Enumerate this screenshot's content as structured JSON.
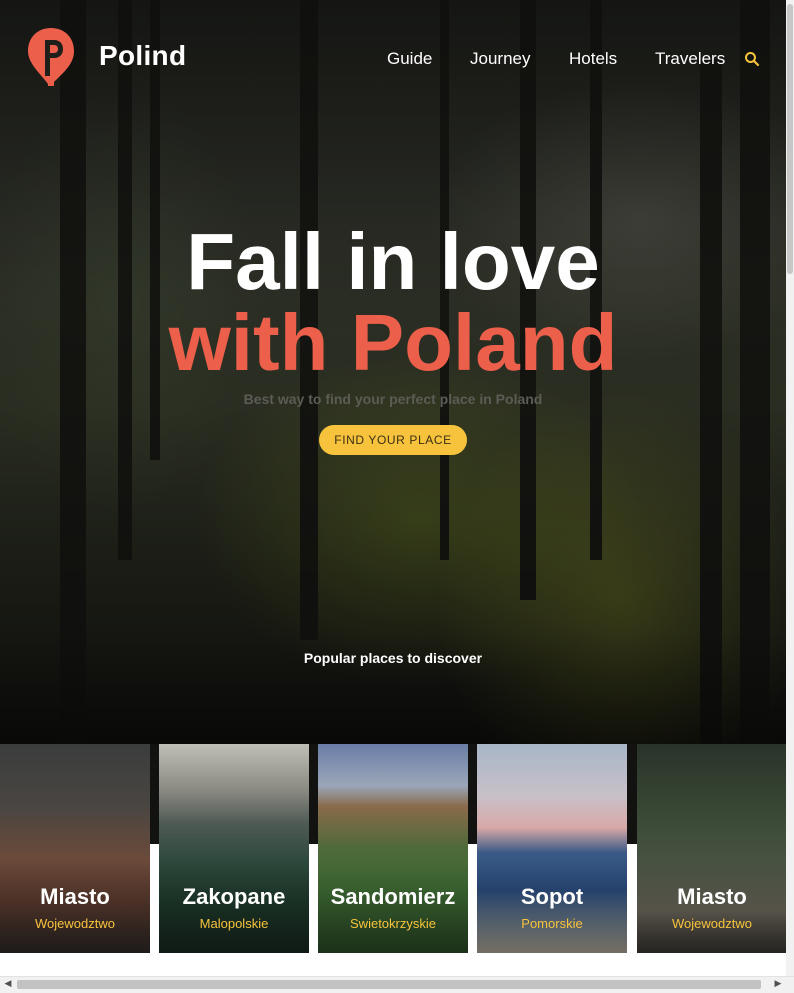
{
  "brand": {
    "name": "Polind"
  },
  "nav": {
    "items": [
      "Guide",
      "Journey",
      "Hotels",
      "Travelers"
    ]
  },
  "icons": {
    "search": "search-icon",
    "logo": "map-pin-logo-icon"
  },
  "hero": {
    "title_line1": "Fall in love",
    "title_line2": "with Poland",
    "subtitle": "Best way to find your perfect place in Poland",
    "cta": "FIND YOUR PLACE",
    "popular_heading": "Popular places to discover"
  },
  "cards": [
    {
      "title": "Miasto",
      "subtitle": "Wojewodztwo"
    },
    {
      "title": "Zakopane",
      "subtitle": "Malopolskie"
    },
    {
      "title": "Sandomierz",
      "subtitle": "Swietokrzyskie"
    },
    {
      "title": "Sopot",
      "subtitle": "Pomorskie"
    },
    {
      "title": "Miasto",
      "subtitle": "Wojewodztwo"
    }
  ],
  "colors": {
    "accent": "#ec5f4a",
    "cta": "#f7c33c",
    "text": "#ffffff"
  }
}
